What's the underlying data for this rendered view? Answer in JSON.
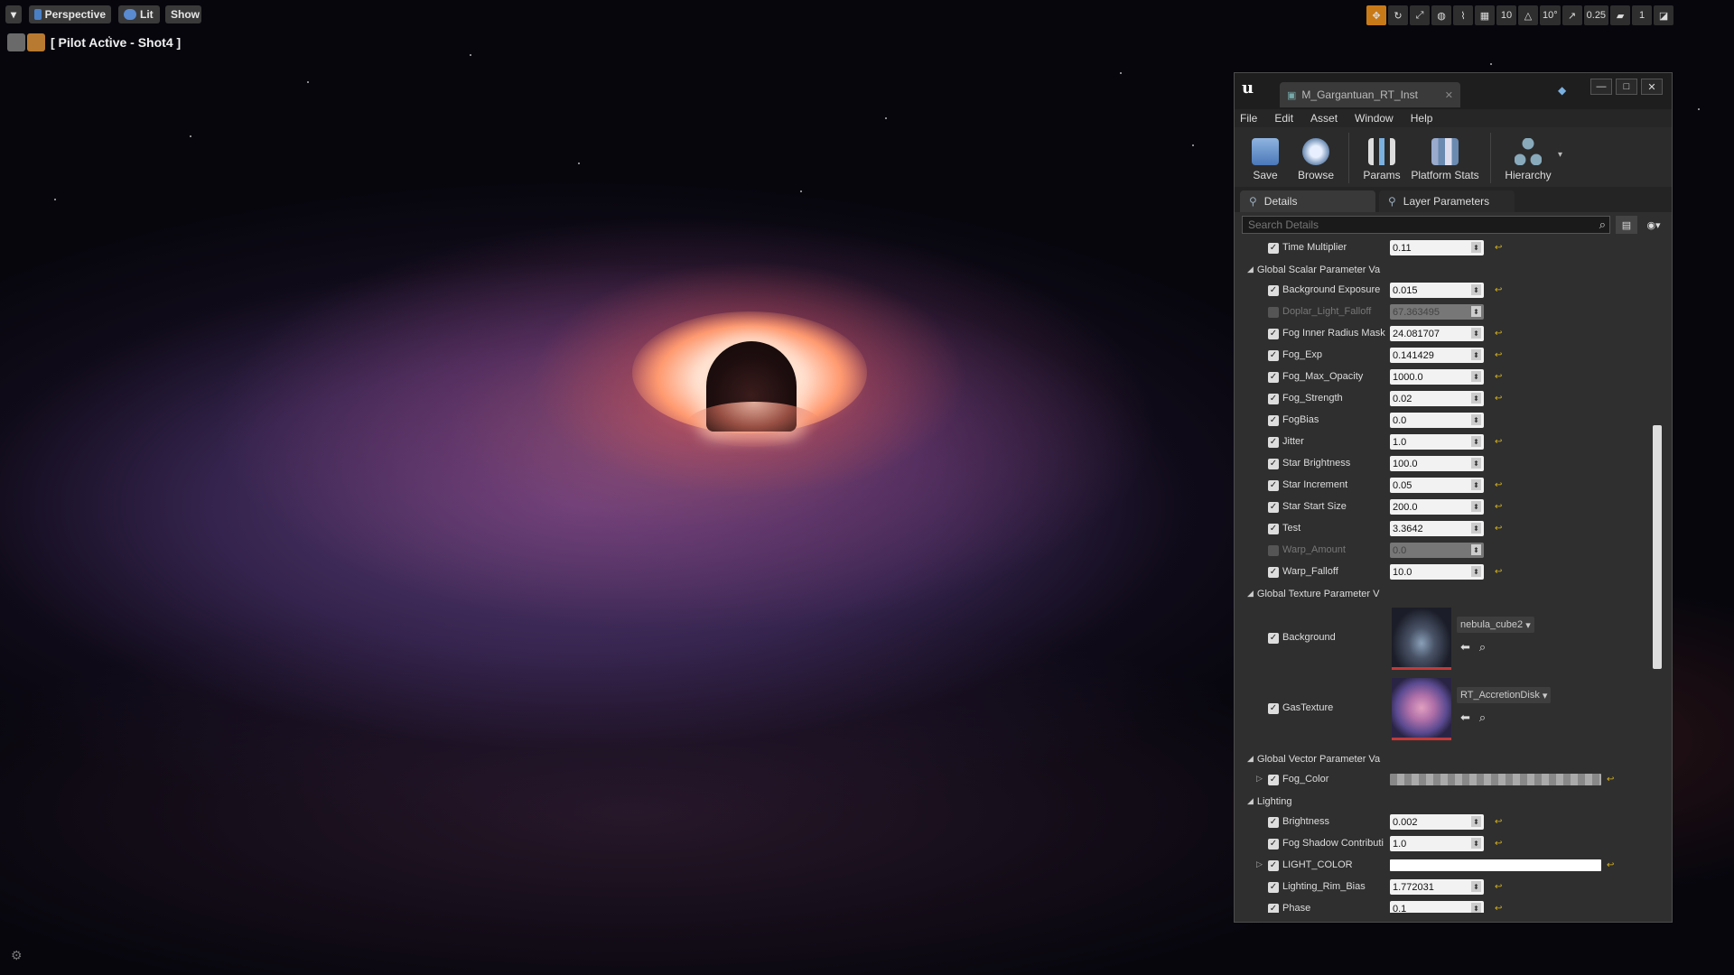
{
  "viewport": {
    "perspective_label": "Perspective",
    "lit_label": "Lit",
    "show_label": "Show",
    "pilot_label": "[ Pilot Active - Shot4 ]",
    "grid_size": "10",
    "rotation_snap": "10°",
    "scale_snap": "0.25",
    "camera_speed": "1"
  },
  "window": {
    "asset_tab": "M_Gargantuan_RT_Inst",
    "minimize": "—",
    "maximize": "□",
    "close": "✕"
  },
  "menu": [
    "File",
    "Edit",
    "Asset",
    "Window",
    "Help"
  ],
  "toolbar": {
    "save": "Save",
    "browse": "Browse",
    "params": "Params",
    "platform_stats": "Platform Stats",
    "hierarchy": "Hierarchy"
  },
  "tabs": {
    "details": "Details",
    "layer_parameters": "Layer Parameters"
  },
  "search": {
    "placeholder": "Search Details"
  },
  "params": {
    "time_multiplier": {
      "label": "Time Multiplier",
      "value": "0.11"
    },
    "cat_global_scalar": "Global Scalar Parameter Va",
    "scalar": [
      {
        "label": "Background Exposure",
        "value": "0.015",
        "enabled": true,
        "reset": true
      },
      {
        "label": "Doplar_Light_Falloff",
        "value": "67.363495",
        "enabled": false,
        "reset": false
      },
      {
        "label": "Fog Inner Radius Mask",
        "value": "24.081707",
        "enabled": true,
        "reset": true
      },
      {
        "label": "Fog_Exp",
        "value": "0.141429",
        "enabled": true,
        "reset": true
      },
      {
        "label": "Fog_Max_Opacity",
        "value": "1000.0",
        "enabled": true,
        "reset": true
      },
      {
        "label": "Fog_Strength",
        "value": "0.02",
        "enabled": true,
        "reset": true
      },
      {
        "label": "FogBias",
        "value": "0.0",
        "enabled": true,
        "reset": false
      },
      {
        "label": "Jitter",
        "value": "1.0",
        "enabled": true,
        "reset": true
      },
      {
        "label": "Star Brightness",
        "value": "100.0",
        "enabled": true,
        "reset": false
      },
      {
        "label": "Star Increment",
        "value": "0.05",
        "enabled": true,
        "reset": true
      },
      {
        "label": "Star Start Size",
        "value": "200.0",
        "enabled": true,
        "reset": true
      },
      {
        "label": "Test",
        "value": "3.3642",
        "enabled": true,
        "reset": true
      },
      {
        "label": "Warp_Amount",
        "value": "0.0",
        "enabled": false,
        "reset": false
      },
      {
        "label": "Warp_Falloff",
        "value": "10.0",
        "enabled": true,
        "reset": true
      }
    ],
    "cat_global_texture": "Global Texture Parameter V",
    "textures": [
      {
        "label": "Background",
        "asset": "nebula_cube2"
      },
      {
        "label": "GasTexture",
        "asset": "RT_AccretionDisk"
      }
    ],
    "cat_global_vector": "Global Vector Parameter Va",
    "fog_color_label": "Fog_Color",
    "cat_lighting": "Lighting",
    "lighting": [
      {
        "label": "Brightness",
        "value": "0.002"
      },
      {
        "label": "Fog Shadow Contributi",
        "value": "1.0"
      }
    ],
    "light_color_label": "LIGHT_COLOR",
    "lighting2": [
      {
        "label": "Lighting_Rim_Bias",
        "value": "1.772031"
      },
      {
        "label": "Phase",
        "value": "0.1"
      }
    ]
  }
}
